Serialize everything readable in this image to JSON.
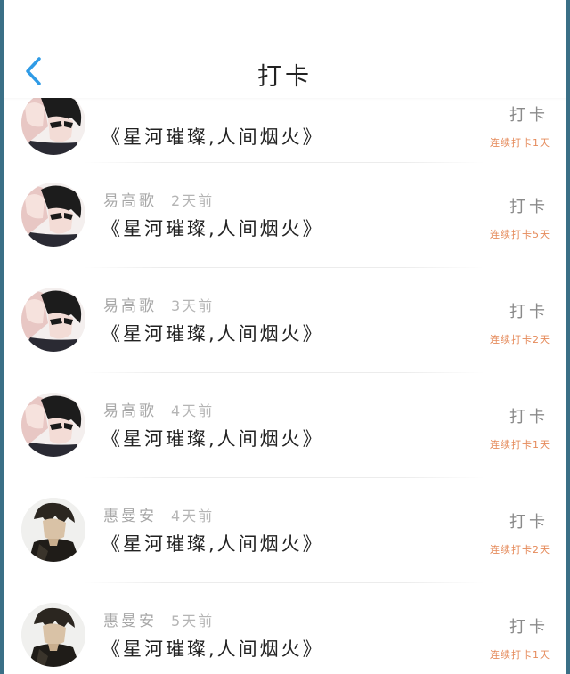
{
  "header": {
    "title": "打卡"
  },
  "rows": [
    {
      "author": "",
      "time": "",
      "content": "《星河璀璨,人间烟火》",
      "action": "打卡",
      "streak": "连续打卡1天",
      "avatar": "girl-boy"
    },
    {
      "author": "易高歌",
      "time": "2天前",
      "content": "《星河璀璨,人间烟火》",
      "action": "打卡",
      "streak": "连续打卡5天",
      "avatar": "girl-boy"
    },
    {
      "author": "易高歌",
      "time": "3天前",
      "content": "《星河璀璨,人间烟火》",
      "action": "打卡",
      "streak": "连续打卡2天",
      "avatar": "girl-boy"
    },
    {
      "author": "易高歌",
      "time": "4天前",
      "content": "《星河璀璨,人间烟火》",
      "action": "打卡",
      "streak": "连续打卡1天",
      "avatar": "girl-boy"
    },
    {
      "author": "惠曼安",
      "time": "4天前",
      "content": "《星河璀璨,人间烟火》",
      "action": "打卡",
      "streak": "连续打卡2天",
      "avatar": "boy-dark"
    },
    {
      "author": "惠曼安",
      "time": "5天前",
      "content": "《星河璀璨,人间烟火》",
      "action": "打卡",
      "streak": "连续打卡1天",
      "avatar": "boy-dark"
    }
  ],
  "colors": {
    "accent": "#2f9be6",
    "streak": "#e58a5a",
    "muted": "#a8a8a8"
  }
}
